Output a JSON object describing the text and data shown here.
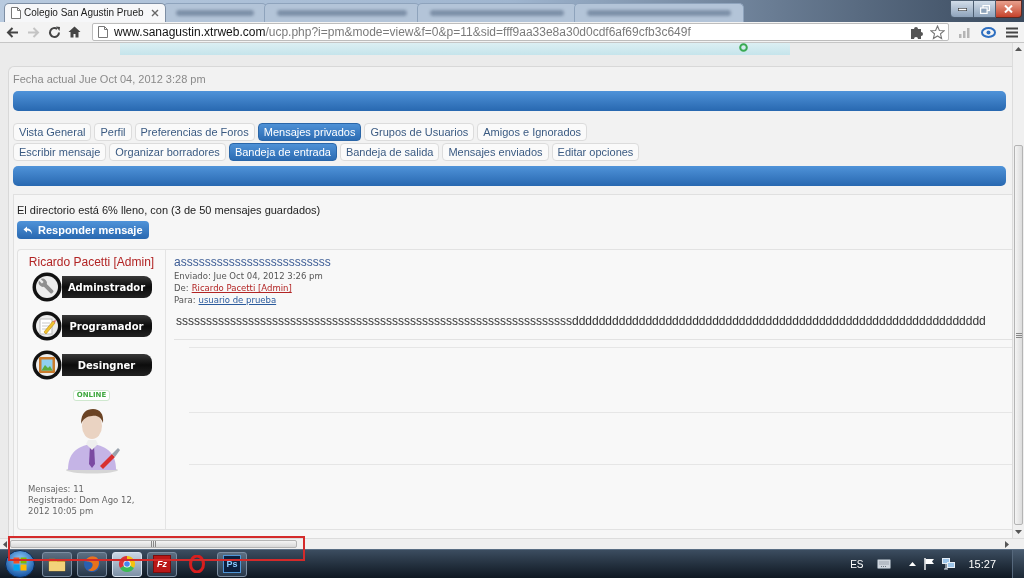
{
  "browser": {
    "tabs": [
      {
        "title": "Colegio San Agustin Prueb",
        "selected": true
      },
      {
        "selected": false
      },
      {
        "selected": false
      },
      {
        "selected": false
      },
      {
        "selected": false
      }
    ],
    "address": {
      "domain": "www.sanagustin.xtrweb.com",
      "path": "/ucp.php?i=pm&mode=view&f=0&p=11&sid=fff9aa33e8a30d0cdf6af69cfb3c649f",
      "forward_disabled": true
    }
  },
  "page": {
    "current_date": "Fecha actual Jue Oct 04, 2012 3:28 pm",
    "main_tabs": [
      {
        "label": "Vista General",
        "selected": false
      },
      {
        "label": "Perfil",
        "selected": false
      },
      {
        "label": "Preferencias de Foros",
        "selected": false
      },
      {
        "label": "Mensajes privados",
        "selected": true
      },
      {
        "label": "Grupos de Usuarios",
        "selected": false
      },
      {
        "label": "Amigos e Ignorados",
        "selected": false
      }
    ],
    "sub_tabs": [
      {
        "label": "Escribir mensaje",
        "selected": false
      },
      {
        "label": "Organizar borradores",
        "selected": false
      },
      {
        "label": "Bandeja de entrada",
        "selected": true
      },
      {
        "label": "Bandeja de salida",
        "selected": false
      },
      {
        "label": "Mensajes enviados",
        "selected": false
      },
      {
        "label": "Editar opciones",
        "selected": false
      }
    ],
    "folder_status": "El directorio está 6% lleno, con (3 de 50 mensajes guardados)",
    "reply_button": "Responder mensaje",
    "post": {
      "author": "Ricardo Pacetti [Admin]",
      "ranks": [
        "Adminstrador",
        "Programador",
        "Desingner"
      ],
      "status_badge": "ONLINE",
      "stats": [
        "Mensajes: 11",
        "Registrado: Dom Ago 12, 2012 10:05 pm"
      ],
      "subject": "asssssssssssssssssssssssss",
      "sent": "Enviado: Jue Oct 04, 2012 3:26 pm",
      "from": {
        "label": "De:",
        "name": "Ricardo Pacetti [Admin]"
      },
      "to": {
        "label": "Para:",
        "name": "usuario de prueba"
      },
      "body": "ssssssssssssssssssssssssssssssssssssssssssssssssssssssssssssssssssdddddddddddddddddddddddddddddddddddddddddddddddddddddddddddddd"
    }
  },
  "taskbar": {
    "apps": [
      {
        "running": true,
        "selected": false
      },
      {
        "running": true,
        "selected": false
      },
      {
        "running": true,
        "selected": true
      },
      {
        "running": true,
        "selected": false,
        "logo": "Fz"
      },
      {
        "running": false,
        "selected": false
      },
      {
        "running": true,
        "selected": false,
        "logo": "Ps"
      }
    ],
    "language": "ES",
    "clock": "15:27"
  }
}
